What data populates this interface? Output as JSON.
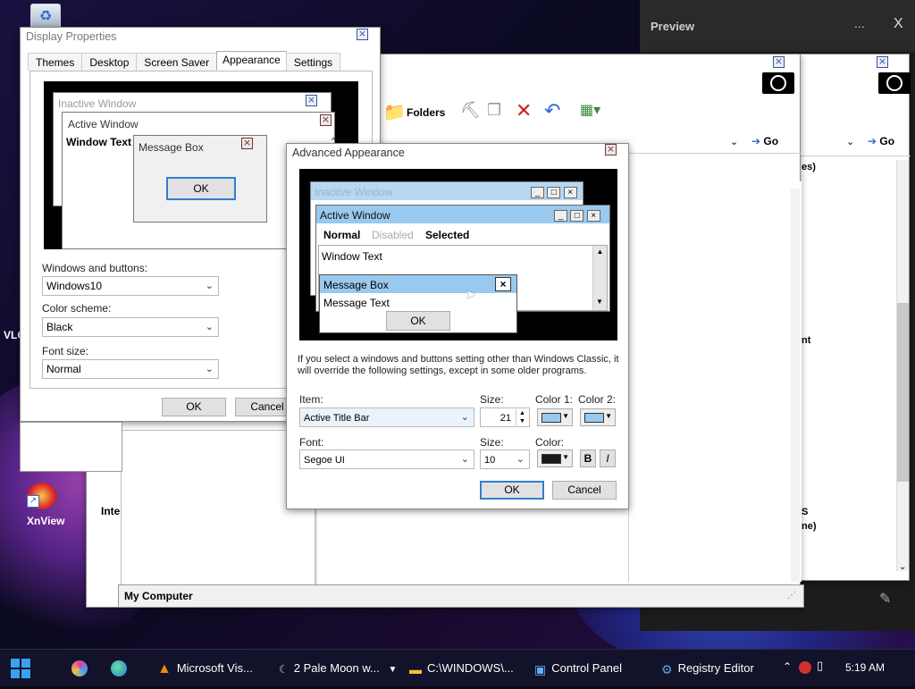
{
  "desktop": {
    "vlc_label": "VLC",
    "xnview_label": "XnView",
    "inte_label": "Inte"
  },
  "preview_window": {
    "title": "Preview",
    "minimize": "...",
    "close": "X"
  },
  "explorer_back": {
    "go_label_1": "Go",
    "go_label_2": "Go",
    "folders_label": "Folders",
    "status_text": "My Computer",
    "right_partial_1": "es)",
    "right_partial_2": "nt",
    "right_partial_3": "S",
    "right_partial_4": "ne)"
  },
  "display_properties": {
    "title": "Display Properties",
    "tabs": [
      "Themes",
      "Desktop",
      "Screen Saver",
      "Appearance",
      "Settings"
    ],
    "active_tab": "Appearance",
    "preview": {
      "inactive_title": "Inactive Window",
      "active_title": "Active Window",
      "window_text": "Window Text",
      "msgbox_title": "Message Box",
      "msgbox_ok": "OK"
    },
    "windows_buttons_label": "Windows and buttons:",
    "windows_buttons_value": "Windows10",
    "color_scheme_label": "Color scheme:",
    "color_scheme_value": "Black",
    "font_size_label": "Font size:",
    "font_size_value": "Normal",
    "ok": "OK",
    "cancel": "Cancel"
  },
  "advanced_appearance": {
    "title": "Advanced Appearance",
    "preview": {
      "inactive_title": "Inactive Window",
      "active_title": "Active Window",
      "menu_normal": "Normal",
      "menu_disabled": "Disabled",
      "menu_selected": "Selected",
      "window_text": "Window Text",
      "msgbox_title": "Message Box",
      "msgbox_text": "Message Text",
      "msgbox_ok": "OK"
    },
    "info_text": "If you select a windows and buttons setting other than Windows Classic, it will override the following settings, except in some older programs.",
    "item_label": "Item:",
    "item_value": "Active Title Bar",
    "size_label": "Size:",
    "size_value": "21",
    "color1_label": "Color 1:",
    "color2_label": "Color 2:",
    "font_label": "Font:",
    "font_value": "Segoe UI",
    "font_size_label": "Size:",
    "font_size_value": "10",
    "color_label": "Color:",
    "bold_label": "B",
    "italic_label": "I",
    "ok": "OK",
    "cancel": "Cancel",
    "colors": {
      "title_bar": "#99c9ef",
      "inactive_title": "#b7d7f2",
      "font_color": "#1a1a1a"
    }
  },
  "taskbar": {
    "items": [
      {
        "label": "Microsoft Vis...",
        "icon": "vlc-cone-icon"
      },
      {
        "label": "2 Pale Moon w...",
        "icon": "pale-moon-icon"
      },
      {
        "label": "C:\\WINDOWS\\...",
        "icon": "folder-icon"
      },
      {
        "label": "Control Panel",
        "icon": "control-panel-icon"
      },
      {
        "label": "Registry Editor",
        "icon": "registry-editor-icon"
      }
    ],
    "clock": "5:19 AM"
  }
}
